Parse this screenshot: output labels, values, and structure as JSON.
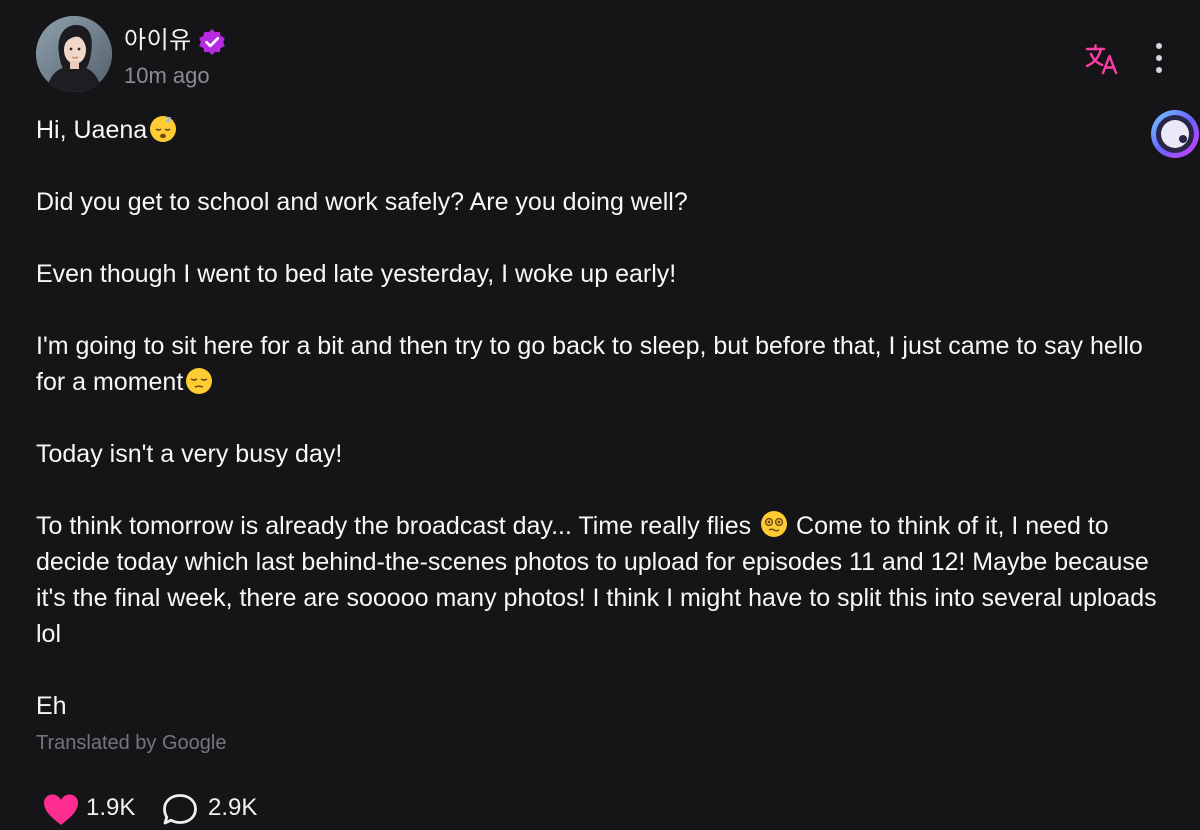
{
  "author": {
    "name": "아이유",
    "time_ago": "10m ago",
    "verified_badge": "verified-badge-icon",
    "verified_color": "#b62be0"
  },
  "actions": {
    "translate_icon": "translate-icon",
    "translate_color": "#ff3da5",
    "more_icon": "more-vertical-icon"
  },
  "content": {
    "paragraphs": [
      {
        "text": "Hi, Uaena",
        "emoji": "sleepy-face-emoji"
      },
      {
        "text": "Did you get to school and work safely? Are you doing well?"
      },
      {
        "text": "Even though I went to bed late yesterday, I woke up early!"
      },
      {
        "text": "I'm going to sit here for a bit and then try to go back to sleep, but before that, I just came to say hello for a moment",
        "emoji": "relieved-face-emoji"
      },
      {
        "text": "Today isn't a very busy day!"
      },
      {
        "text_before": "To think tomorrow is already the broadcast day... Time really flies ",
        "emoji": "dizzy-face-emoji",
        "text_after": " Come to think of it, I need to decide today which last behind-the-scenes photos to upload for episodes 11 and 12! Maybe because it's the final week, there are sooooo many photos! I think I might have to split this into several uploads lol"
      },
      {
        "text": "Eh"
      }
    ],
    "translation_note": "Translated by Google"
  },
  "stats": {
    "likes": "1.9K",
    "comments": "2.9K",
    "like_color": "#ff2d8f"
  }
}
